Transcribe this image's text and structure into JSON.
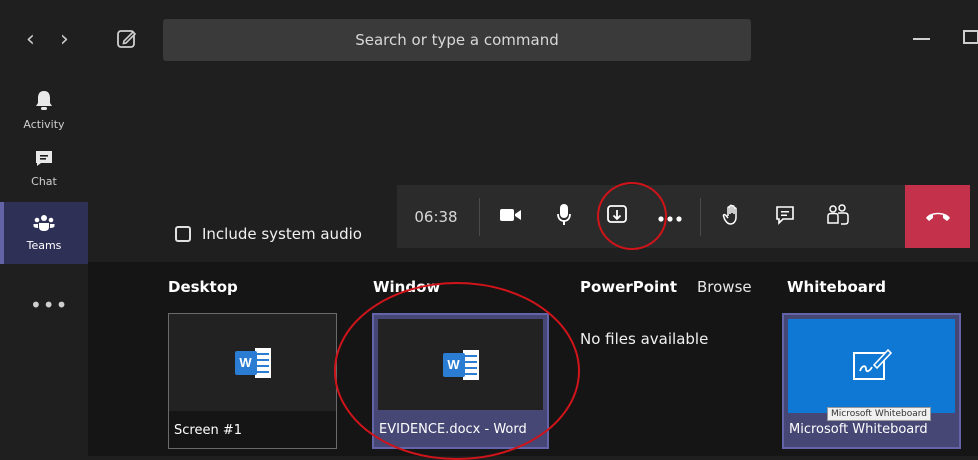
{
  "topbar": {
    "search_placeholder": "Search or type a command",
    "back_glyph": "‹",
    "forward_glyph": "›"
  },
  "rail": {
    "items": [
      {
        "label": "Activity",
        "icon": "bell-icon"
      },
      {
        "label": "Chat",
        "icon": "chat-icon"
      },
      {
        "label": "Teams",
        "icon": "teams-icon",
        "active": true
      }
    ],
    "more_glyph": "•••"
  },
  "call": {
    "timer": "06:38",
    "buttons": [
      "camera-icon",
      "microphone-icon",
      "share-screen-icon",
      "more-icon",
      "raise-hand-icon",
      "chat-icon",
      "participants-icon",
      "hang-up-icon"
    ],
    "hangup_color": "#c4314b"
  },
  "share": {
    "include_audio_label": "Include system audio",
    "headings": {
      "desktop": "Desktop",
      "window": "Window",
      "powerpoint": "PowerPoint",
      "browse": "Browse",
      "whiteboard": "Whiteboard"
    },
    "desktop_tile": {
      "caption": "Screen #1"
    },
    "window_tile": {
      "caption": "EVIDENCE.docx - Word"
    },
    "powerpoint_empty": "No files available",
    "whiteboard_tile": {
      "caption": "Microsoft Whiteboard",
      "tooltip": "Microsoft Whiteboard"
    },
    "word_icon_letter": "W"
  },
  "colors": {
    "accent": "#6264a7",
    "annotation_red": "#d0141a",
    "whiteboard_blue": "#0f78d4"
  }
}
